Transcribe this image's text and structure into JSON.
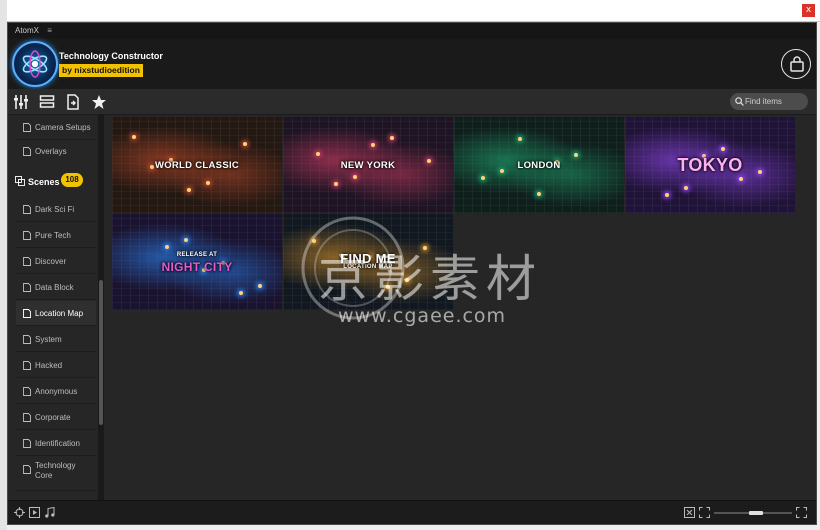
{
  "window": {
    "title": "AtomX",
    "menu_icon": "hamburger-icon",
    "close_label": "x"
  },
  "header": {
    "app_title": "Technology Constructor",
    "subtitle": "by nixstudioedition",
    "subtitle_color": "#f2c200",
    "cart_icon": "shopping-bag-icon"
  },
  "toolbar": {
    "icons": [
      "sliders-icon",
      "list-layout-icon",
      "import-icon",
      "star-icon"
    ],
    "search_placeholder": "Find items"
  },
  "sidebar": {
    "items_top": [
      {
        "label": "Camera Setups"
      },
      {
        "label": "Overlays"
      }
    ],
    "section": {
      "label": "Scenes",
      "count": "108"
    },
    "items": [
      {
        "label": "Dark Sci Fi"
      },
      {
        "label": "Pure Tech"
      },
      {
        "label": "Discover"
      },
      {
        "label": "Data Block"
      },
      {
        "label": "Location Map",
        "active": true
      },
      {
        "label": "System"
      },
      {
        "label": "Hacked"
      },
      {
        "label": "Anonymous"
      },
      {
        "label": "Corporate"
      },
      {
        "label": "Identification"
      },
      {
        "label": "Technology Core"
      }
    ]
  },
  "tiles": [
    {
      "label": "WORLD CLASSIC",
      "tint": "#b2472a"
    },
    {
      "label": "NEW YORK",
      "tint": "#c23a5e"
    },
    {
      "label": "LONDON",
      "tint": "#1f9c6a"
    },
    {
      "label": "TOKYO",
      "tint": "#8a45e0"
    },
    {
      "label": "NIGHT CITY",
      "small": "RELEASE AT",
      "tint": "#2a7ae0"
    },
    {
      "label": "FIND ME",
      "small": "LOCATION MAP",
      "tint": "#c2862a"
    }
  ],
  "status": {
    "icons": [
      "target-icon",
      "play-icon",
      "music-note-icon",
      "fit-icon",
      "fullscreen-icon",
      "expand-icon"
    ],
    "zoom_level": 0.55
  },
  "watermark": {
    "cn": "京影素材",
    "url": "www.cgaee.com"
  }
}
